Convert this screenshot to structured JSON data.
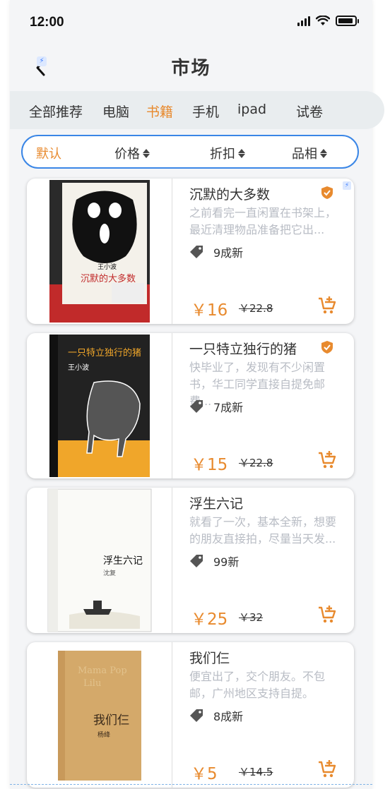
{
  "status_bar": {
    "time": "12:00"
  },
  "header": {
    "title": "市场",
    "back_icon": "chevron-left-icon"
  },
  "categories": [
    {
      "label": "全部推荐",
      "active": false
    },
    {
      "label": "电脑",
      "active": false
    },
    {
      "label": "书籍",
      "active": true
    },
    {
      "label": "手机",
      "active": false
    },
    {
      "label": "ipad",
      "active": false
    },
    {
      "label": "试卷",
      "active": false
    }
  ],
  "filters": [
    {
      "label": "默认",
      "active": true
    },
    {
      "label": "价格",
      "active": false
    },
    {
      "label": "折扣",
      "active": false
    },
    {
      "label": "品相",
      "active": false
    }
  ],
  "products": [
    {
      "title": "沉默的大多数",
      "desc": "之前看完一直闲置在书架上，最近清理物品准备把它出...",
      "condition": "9成新",
      "price": "￥16",
      "original_price": "￥22.8",
      "verified": true,
      "cover": {
        "main": "沉默的大多数",
        "author": "王小波"
      }
    },
    {
      "title": "一只特立独行的猪",
      "desc": "快毕业了，发现有不少闲置书，华工同学直接自提免邮费...",
      "condition": "7成新",
      "price": "￥15",
      "original_price": "￥22.8",
      "verified": true,
      "cover": {
        "main": "一只特立独行的猪",
        "author": "王小波"
      }
    },
    {
      "title": "浮生六记",
      "desc": "就看了一次，基本全新，想要的朋友直接拍，尽量当天发...",
      "condition": "99新",
      "price": "￥25",
      "original_price": "￥32",
      "verified": false,
      "cover": {
        "main": "浮生六记",
        "author": "沈复"
      }
    },
    {
      "title": "我们仨",
      "desc": "便宜出了，交个朋友。不包邮，广州地区支持自提。",
      "condition": "8成新",
      "price": "￥5",
      "original_price": "￥14.5",
      "verified": false,
      "cover": {
        "main": "我们仨",
        "author": "杨绛"
      }
    }
  ],
  "colors": {
    "accent": "#e88a2e",
    "filter_border": "#3a86e6",
    "badge": "#e88a2e"
  },
  "icons": {
    "condition": "tag-icon",
    "cart": "cart-plus-icon",
    "verified": "shield-check-icon",
    "sort": "sort-arrows-icon"
  }
}
